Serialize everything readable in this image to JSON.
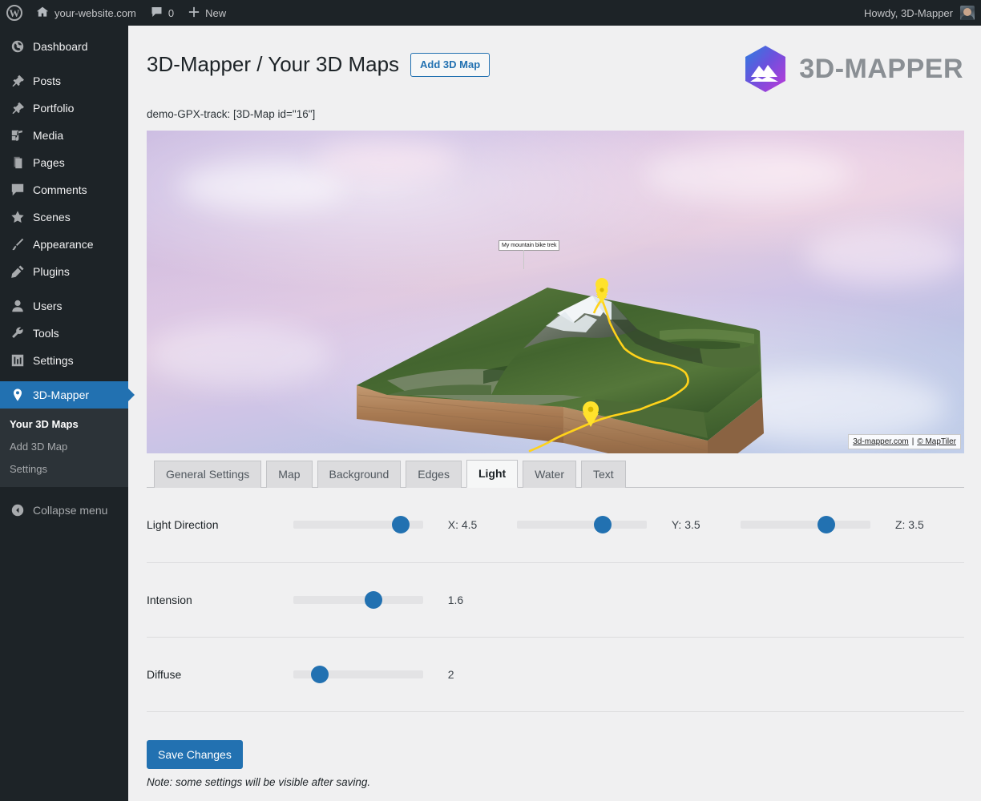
{
  "adminbar": {
    "wp_logo": "wordpress-logo",
    "site_name": "your-website.com",
    "comments_count": "0",
    "new_label": "New",
    "howdy": "Howdy, 3D-Mapper"
  },
  "sidebar": {
    "items": [
      {
        "label": "Dashboard",
        "icon": "dashboard-icon"
      },
      {
        "label": "Posts",
        "icon": "pin-icon"
      },
      {
        "label": "Portfolio",
        "icon": "pin-icon"
      },
      {
        "label": "Media",
        "icon": "media-icon"
      },
      {
        "label": "Pages",
        "icon": "pages-icon"
      },
      {
        "label": "Comments",
        "icon": "comments-icon"
      },
      {
        "label": "Scenes",
        "icon": "star-icon"
      },
      {
        "label": "Appearance",
        "icon": "brush-icon"
      },
      {
        "label": "Plugins",
        "icon": "plug-icon"
      },
      {
        "label": "Users",
        "icon": "user-icon"
      },
      {
        "label": "Tools",
        "icon": "wrench-icon"
      },
      {
        "label": "Settings",
        "icon": "sliders-icon"
      },
      {
        "label": "3D-Mapper",
        "icon": "map-pin-icon",
        "current": true
      }
    ],
    "submenu": [
      {
        "label": "Your 3D Maps",
        "current": true
      },
      {
        "label": "Add 3D Map",
        "current": false
      },
      {
        "label": "Settings",
        "current": false
      }
    ],
    "collapse_label": "Collapse menu",
    "highlight_color": "#2271b1"
  },
  "brand": {
    "wordmark": "3D-MAPPER",
    "logo": "3d-mapper-hexagon-logo",
    "gradient_from": "#2b7fe0",
    "gradient_to": "#c038d8"
  },
  "page": {
    "title": "3D-Mapper / Your 3D Maps",
    "add_button": "Add 3D Map",
    "shortcode_line": "demo-GPX-track: [3D-Map id=\"16\"]"
  },
  "viewer": {
    "map_label": "My mountain bike trek",
    "attribution_site": "3d-mapper.com",
    "attribution_separator": "|",
    "attribution_provider": "© MapTiler",
    "markers": [
      "summit-marker",
      "valley-marker"
    ],
    "track_color": "#ffd21a"
  },
  "tabs": [
    {
      "label": "General Settings",
      "active": false
    },
    {
      "label": "Map",
      "active": false
    },
    {
      "label": "Background",
      "active": false
    },
    {
      "label": "Edges",
      "active": false
    },
    {
      "label": "Light",
      "active": true
    },
    {
      "label": "Water",
      "active": false
    },
    {
      "label": "Text",
      "active": false
    }
  ],
  "settings": {
    "rows": [
      {
        "label": "Light Direction",
        "sliders": [
          {
            "value_text": "X: 4.5",
            "percent": 88
          },
          {
            "value_text": "Y: 3.5",
            "percent": 69
          },
          {
            "value_text": "Z: 3.5",
            "percent": 69
          }
        ]
      },
      {
        "label": "Intension",
        "sliders": [
          {
            "value_text": "1.6",
            "percent": 64
          }
        ]
      },
      {
        "label": "Diffuse",
        "sliders": [
          {
            "value_text": "2",
            "percent": 16
          }
        ]
      }
    ],
    "save_label": "Save Changes",
    "note": "Note: some settings will be visible after saving."
  }
}
